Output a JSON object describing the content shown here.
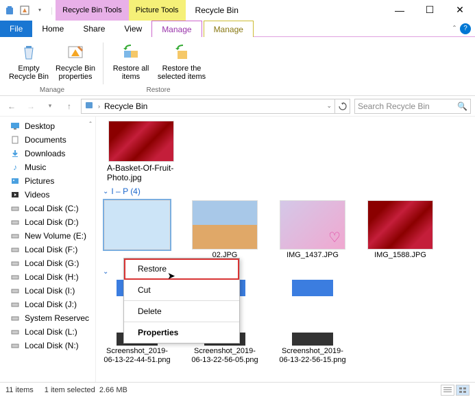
{
  "titlebar": {
    "tool1_title": "Recycle Bin Tools",
    "tool2_title": "Picture Tools",
    "window_title": "Recycle Bin"
  },
  "tabs": {
    "file": "File",
    "home": "Home",
    "share": "Share",
    "view": "View",
    "manage1": "Manage",
    "manage2": "Manage"
  },
  "ribbon": {
    "empty": "Empty Recycle Bin",
    "props": "Recycle Bin properties",
    "restore_all": "Restore all items",
    "restore_sel": "Restore the selected items",
    "group_manage": "Manage",
    "group_restore": "Restore"
  },
  "address": {
    "location": "Recycle Bin",
    "search_placeholder": "Search Recycle Bin"
  },
  "nav": {
    "items": [
      "Desktop",
      "Documents",
      "Downloads",
      "Music",
      "Pictures",
      "Videos",
      "Local Disk (C:)",
      "Local Disk (D:)",
      "New Volume (E:)",
      "Local Disk (F:)",
      "Local Disk (G:)",
      "Local Disk (H:)",
      "Local Disk (I:)",
      "Local Disk (J:)",
      "System Reservec",
      "Local Disk (L:)",
      "Local Disk (N:)"
    ]
  },
  "files": {
    "basket": "A-Basket-Of-Fruit-Photo.jpg",
    "group_ip": "I – P (4)",
    "img02": "02.JPG",
    "img1437": "IMG_1437.JPG",
    "img1588": "IMG_1588.JPG",
    "ss1": "Screenshot_2019-06-13-22-44-51.png",
    "ss2": "Screenshot_2019-06-13-22-56-05.png",
    "ss3": "Screenshot_2019-06-13-22-56-15.png"
  },
  "context_menu": {
    "restore": "Restore",
    "cut": "Cut",
    "delete": "Delete",
    "properties": "Properties"
  },
  "status": {
    "count": "11 items",
    "selected": "1 item selected",
    "size": "2.66 MB"
  }
}
